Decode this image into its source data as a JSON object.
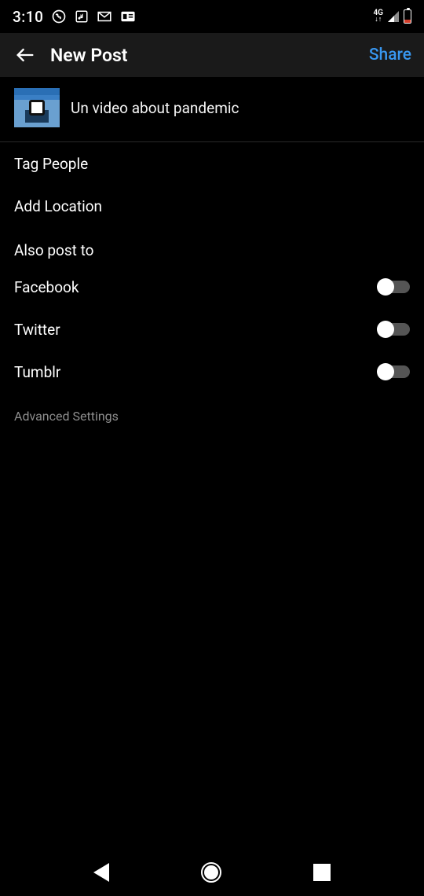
{
  "status": {
    "time": "3:10",
    "network_label": "4G"
  },
  "header": {
    "title": "New Post",
    "share_label": "Share"
  },
  "caption": {
    "text": "Un video about pandemic"
  },
  "options": {
    "tag_people": "Tag People",
    "add_location": "Add Location"
  },
  "also_post": {
    "label": "Also post to",
    "services": [
      {
        "name": "Facebook",
        "on": false
      },
      {
        "name": "Twitter",
        "on": false
      },
      {
        "name": "Tumblr",
        "on": false
      }
    ]
  },
  "advanced_label": "Advanced Settings"
}
